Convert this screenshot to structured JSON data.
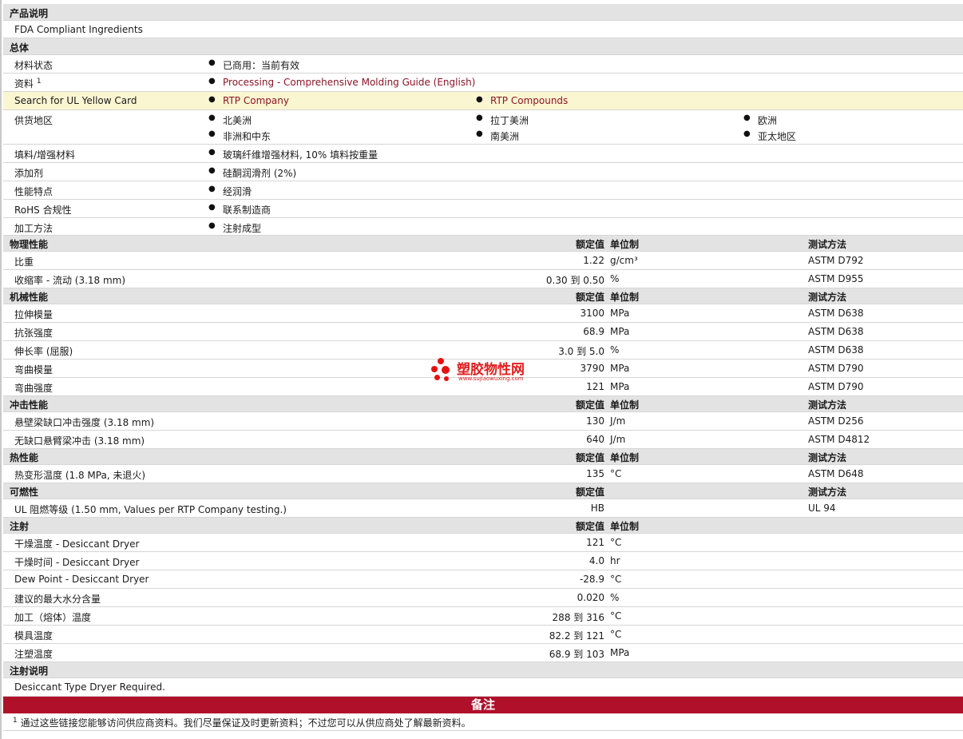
{
  "sections": {
    "product": "产品说明",
    "product_line": "FDA Compliant Ingredients",
    "general": "总体",
    "physical": "物理性能",
    "mechanical": "机械性能",
    "impact": "冲击性能",
    "thermal": "热性能",
    "flammability": "可燃性",
    "injection": "注射",
    "injection_notes": "注射说明",
    "injection_notes_line": "Desiccant Type Dryer Required."
  },
  "columns": {
    "nominal": "额定值",
    "unit": "单位制",
    "method": "测试方法"
  },
  "general": {
    "material_status_label": "材料状态",
    "material_status": "已商用：当前有效",
    "docs_label": "资料",
    "docs_sup": "1",
    "docs_link": "Processing - Comprehensive Molding Guide (English)",
    "ul_label": "Search for UL Yellow Card",
    "ul_link_1": "RTP Company",
    "ul_link_2": "RTP Compounds",
    "supply_label": "供货地区",
    "regions": [
      "北美洲",
      "拉丁美洲",
      "欧洲",
      "非洲和中东",
      "南美洲",
      "亚太地区"
    ],
    "filler_label": "填料/增强材料",
    "filler": "玻璃纤维增强材料, 10% 填料按重量",
    "additive_label": "添加剂",
    "additive": "硅酮润滑剂 (2%)",
    "features_label": "性能特点",
    "features": "经润滑",
    "rohs_label": "RoHS 合规性",
    "rohs": "联系制造商",
    "processing_label": "加工方法",
    "processing": "注射成型"
  },
  "physical_rows": [
    {
      "label": "比重",
      "value": "1.22",
      "unit": "g/cm³",
      "method": "ASTM D792"
    },
    {
      "label": "收缩率  - 流动  (3.18 mm)",
      "value": "0.30 到  0.50",
      "unit": "%",
      "method": "ASTM D955"
    }
  ],
  "mechanical_rows": [
    {
      "label": "拉伸模量",
      "value": "3100",
      "unit": "MPa",
      "method": "ASTM D638"
    },
    {
      "label": "抗张强度",
      "value": "68.9",
      "unit": "MPa",
      "method": "ASTM D638"
    },
    {
      "label": "伸长率  (屈服)",
      "value": "3.0 到  5.0",
      "unit": "%",
      "method": "ASTM D638"
    },
    {
      "label": "弯曲模量",
      "value": "3790",
      "unit": "MPa",
      "method": "ASTM D790"
    },
    {
      "label": "弯曲强度",
      "value": "121",
      "unit": "MPa",
      "method": "ASTM D790"
    }
  ],
  "impact_rows": [
    {
      "label": "悬壁梁缺口冲击强度  (3.18 mm)",
      "value": "130",
      "unit": "J/m",
      "method": "ASTM D256"
    },
    {
      "label": "无缺口悬臂梁冲击  (3.18 mm)",
      "value": "640",
      "unit": "J/m",
      "method": "ASTM D4812"
    }
  ],
  "thermal_rows": [
    {
      "label": "热变形温度  (1.8 MPa, 未退火)",
      "value": "135",
      "unit": "°C",
      "method": "ASTM D648"
    }
  ],
  "flammability_rows": [
    {
      "label": "UL 阻燃等级  (1.50 mm, Values per RTP Company testing.)",
      "value": "HB",
      "unit": "",
      "method": "UL 94"
    }
  ],
  "injection_rows": [
    {
      "label": "干燥温度  - Desiccant Dryer",
      "value": "121",
      "unit": "°C"
    },
    {
      "label": "干燥时间  - Desiccant Dryer",
      "value": "4.0",
      "unit": "hr"
    },
    {
      "label": "Dew Point - Desiccant Dryer",
      "value": "-28.9",
      "unit": "°C"
    },
    {
      "label": "建议的最大水分含量",
      "value": "0.020",
      "unit": "%"
    },
    {
      "label": "加工（熔体）温度",
      "value": "288 到  316",
      "unit": "°C"
    },
    {
      "label": "模具温度",
      "value": "82.2 到  121",
      "unit": "°C"
    },
    {
      "label": "注塑温度",
      "value": "68.9 到  103",
      "unit": "MPa"
    }
  ],
  "notes": {
    "banner": "备注",
    "sup": "1",
    "text": "通过这些链接您能够访问供应商资料。我们尽量保证及时更新资料；不过您可以从供应商处了解最新资料。"
  },
  "watermark": {
    "text": "塑胶物性网",
    "url": "www.sujiaowuxing.com"
  },
  "colors": {
    "link": "#8a1525",
    "banner": "#b0102a",
    "header_bg": "#e3e3e3",
    "highlight_bg": "#fbf6d2",
    "watermark": "#e81010"
  },
  "icons": {
    "bullet": "bullet-dot-icon",
    "watermark_logo": "dots-logo-icon"
  }
}
